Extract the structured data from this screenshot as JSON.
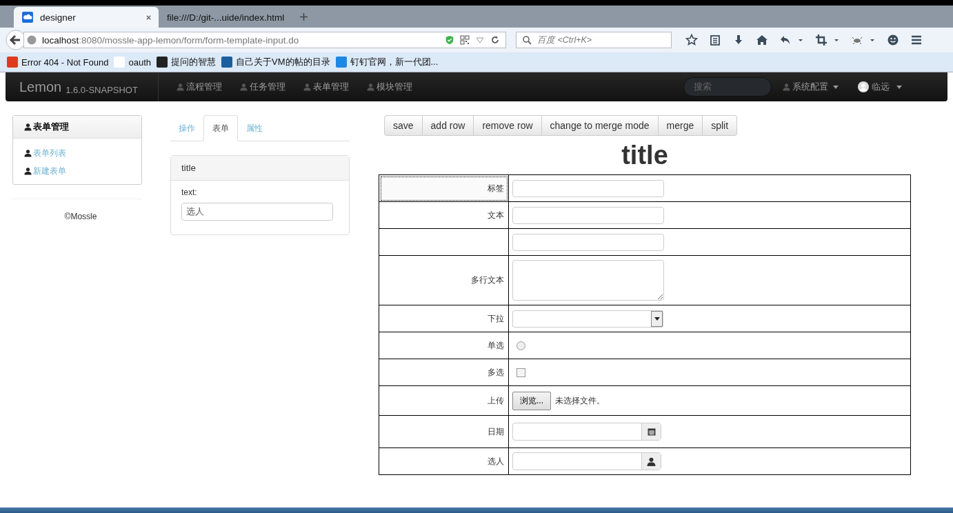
{
  "browser": {
    "tabs": [
      {
        "title": "designer",
        "selected": true
      },
      {
        "title": "file:///D:/git-...uide/index.html",
        "selected": false
      }
    ],
    "address": {
      "host": "localhost",
      "path": ":8080/mossle-app-lemon/form/form-template-input.do"
    },
    "search": {
      "placeholder": "百度 <Ctrl+K>"
    },
    "bookmarks": [
      "Error 404 - Not Found",
      "oauth",
      "提问的智慧",
      "自己关于VM的帖的目录",
      "钉钉官网，新一代团..."
    ]
  },
  "navbar": {
    "brand": "Lemon",
    "version": "1.6.0-SNAPSHOT",
    "menu": [
      "流程管理",
      "任务管理",
      "表单管理",
      "模块管理"
    ],
    "search": {
      "placeholder": "搜索"
    },
    "settings": "系统配置",
    "user": "临远"
  },
  "sidebar": {
    "heading": "表单管理",
    "items": [
      "表单列表",
      "新建表单"
    ],
    "footer": "©Mossle"
  },
  "designer_tabs": [
    {
      "label": "操作",
      "selected": false
    },
    {
      "label": "表单",
      "selected": true
    },
    {
      "label": "属性",
      "selected": false
    }
  ],
  "properties": {
    "title": "title",
    "label": "text:",
    "value": "选人"
  },
  "toolbar": [
    "save",
    "add row",
    "remove row",
    "change to merge mode",
    "merge",
    "split"
  ],
  "form": {
    "title": "title",
    "rows": [
      {
        "label": "标签",
        "kind": "text",
        "selected": true
      },
      {
        "label": "文本",
        "kind": "text",
        "selected": false
      },
      {
        "kind": "text",
        "selected": false
      },
      {
        "label": "多行文本",
        "kind": "textarea",
        "selected": false
      },
      {
        "label": "下拉",
        "kind": "select",
        "selected": false
      },
      {
        "label": "单选",
        "kind": "radio",
        "checked": false,
        "selected": false
      },
      {
        "label": "多选",
        "kind": "checkbox",
        "checked": false,
        "selected": false
      },
      {
        "label": "上传",
        "kind": "file",
        "button": "浏览...",
        "status": "未选择文件。",
        "selected": false
      },
      {
        "label": "日期",
        "kind": "date",
        "selected": false
      },
      {
        "label": "选人",
        "kind": "user",
        "selected": false
      }
    ]
  }
}
